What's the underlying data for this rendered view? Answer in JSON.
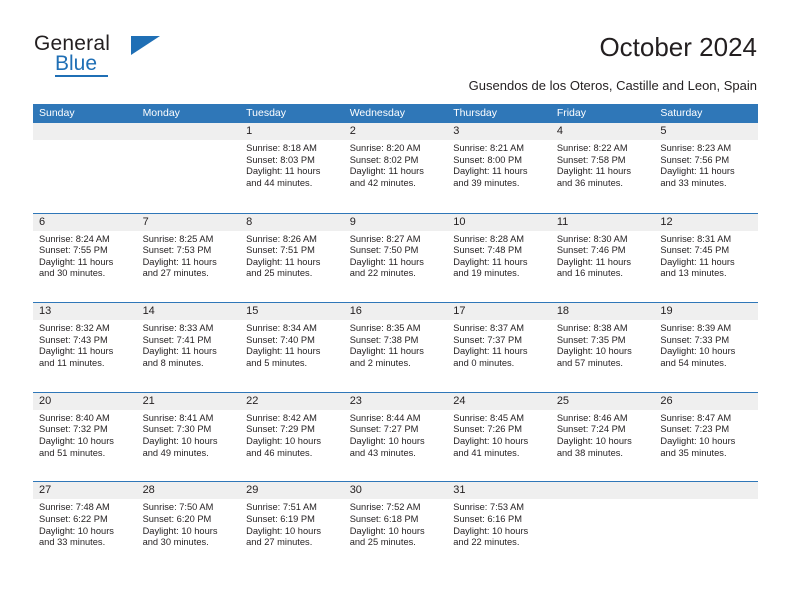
{
  "logo": {
    "word_one": "General",
    "word_two": "Blue",
    "triangle_icon": "triangle-icon",
    "accent_color": "#1f6fb5"
  },
  "header": {
    "title": "October 2024",
    "subtitle": "Gusendos de los Oteros, Castille and Leon, Spain"
  },
  "calendar": {
    "header_bg": "#2f77b8",
    "date_strip_bg": "#efefef",
    "weekdays": [
      "Sunday",
      "Monday",
      "Tuesday",
      "Wednesday",
      "Thursday",
      "Friday",
      "Saturday"
    ],
    "weeks": [
      [
        {
          "date": ""
        },
        {
          "date": ""
        },
        {
          "date": "1",
          "sunrise": "Sunrise: 8:18 AM",
          "sunset": "Sunset: 8:03 PM",
          "daylight_line1": "Daylight: 11 hours",
          "daylight_line2": "and 44 minutes."
        },
        {
          "date": "2",
          "sunrise": "Sunrise: 8:20 AM",
          "sunset": "Sunset: 8:02 PM",
          "daylight_line1": "Daylight: 11 hours",
          "daylight_line2": "and 42 minutes."
        },
        {
          "date": "3",
          "sunrise": "Sunrise: 8:21 AM",
          "sunset": "Sunset: 8:00 PM",
          "daylight_line1": "Daylight: 11 hours",
          "daylight_line2": "and 39 minutes."
        },
        {
          "date": "4",
          "sunrise": "Sunrise: 8:22 AM",
          "sunset": "Sunset: 7:58 PM",
          "daylight_line1": "Daylight: 11 hours",
          "daylight_line2": "and 36 minutes."
        },
        {
          "date": "5",
          "sunrise": "Sunrise: 8:23 AM",
          "sunset": "Sunset: 7:56 PM",
          "daylight_line1": "Daylight: 11 hours",
          "daylight_line2": "and 33 minutes."
        }
      ],
      [
        {
          "date": "6",
          "sunrise": "Sunrise: 8:24 AM",
          "sunset": "Sunset: 7:55 PM",
          "daylight_line1": "Daylight: 11 hours",
          "daylight_line2": "and 30 minutes."
        },
        {
          "date": "7",
          "sunrise": "Sunrise: 8:25 AM",
          "sunset": "Sunset: 7:53 PM",
          "daylight_line1": "Daylight: 11 hours",
          "daylight_line2": "and 27 minutes."
        },
        {
          "date": "8",
          "sunrise": "Sunrise: 8:26 AM",
          "sunset": "Sunset: 7:51 PM",
          "daylight_line1": "Daylight: 11 hours",
          "daylight_line2": "and 25 minutes."
        },
        {
          "date": "9",
          "sunrise": "Sunrise: 8:27 AM",
          "sunset": "Sunset: 7:50 PM",
          "daylight_line1": "Daylight: 11 hours",
          "daylight_line2": "and 22 minutes."
        },
        {
          "date": "10",
          "sunrise": "Sunrise: 8:28 AM",
          "sunset": "Sunset: 7:48 PM",
          "daylight_line1": "Daylight: 11 hours",
          "daylight_line2": "and 19 minutes."
        },
        {
          "date": "11",
          "sunrise": "Sunrise: 8:30 AM",
          "sunset": "Sunset: 7:46 PM",
          "daylight_line1": "Daylight: 11 hours",
          "daylight_line2": "and 16 minutes."
        },
        {
          "date": "12",
          "sunrise": "Sunrise: 8:31 AM",
          "sunset": "Sunset: 7:45 PM",
          "daylight_line1": "Daylight: 11 hours",
          "daylight_line2": "and 13 minutes."
        }
      ],
      [
        {
          "date": "13",
          "sunrise": "Sunrise: 8:32 AM",
          "sunset": "Sunset: 7:43 PM",
          "daylight_line1": "Daylight: 11 hours",
          "daylight_line2": "and 11 minutes."
        },
        {
          "date": "14",
          "sunrise": "Sunrise: 8:33 AM",
          "sunset": "Sunset: 7:41 PM",
          "daylight_line1": "Daylight: 11 hours",
          "daylight_line2": "and 8 minutes."
        },
        {
          "date": "15",
          "sunrise": "Sunrise: 8:34 AM",
          "sunset": "Sunset: 7:40 PM",
          "daylight_line1": "Daylight: 11 hours",
          "daylight_line2": "and 5 minutes."
        },
        {
          "date": "16",
          "sunrise": "Sunrise: 8:35 AM",
          "sunset": "Sunset: 7:38 PM",
          "daylight_line1": "Daylight: 11 hours",
          "daylight_line2": "and 2 minutes."
        },
        {
          "date": "17",
          "sunrise": "Sunrise: 8:37 AM",
          "sunset": "Sunset: 7:37 PM",
          "daylight_line1": "Daylight: 11 hours",
          "daylight_line2": "and 0 minutes."
        },
        {
          "date": "18",
          "sunrise": "Sunrise: 8:38 AM",
          "sunset": "Sunset: 7:35 PM",
          "daylight_line1": "Daylight: 10 hours",
          "daylight_line2": "and 57 minutes."
        },
        {
          "date": "19",
          "sunrise": "Sunrise: 8:39 AM",
          "sunset": "Sunset: 7:33 PM",
          "daylight_line1": "Daylight: 10 hours",
          "daylight_line2": "and 54 minutes."
        }
      ],
      [
        {
          "date": "20",
          "sunrise": "Sunrise: 8:40 AM",
          "sunset": "Sunset: 7:32 PM",
          "daylight_line1": "Daylight: 10 hours",
          "daylight_line2": "and 51 minutes."
        },
        {
          "date": "21",
          "sunrise": "Sunrise: 8:41 AM",
          "sunset": "Sunset: 7:30 PM",
          "daylight_line1": "Daylight: 10 hours",
          "daylight_line2": "and 49 minutes."
        },
        {
          "date": "22",
          "sunrise": "Sunrise: 8:42 AM",
          "sunset": "Sunset: 7:29 PM",
          "daylight_line1": "Daylight: 10 hours",
          "daylight_line2": "and 46 minutes."
        },
        {
          "date": "23",
          "sunrise": "Sunrise: 8:44 AM",
          "sunset": "Sunset: 7:27 PM",
          "daylight_line1": "Daylight: 10 hours",
          "daylight_line2": "and 43 minutes."
        },
        {
          "date": "24",
          "sunrise": "Sunrise: 8:45 AM",
          "sunset": "Sunset: 7:26 PM",
          "daylight_line1": "Daylight: 10 hours",
          "daylight_line2": "and 41 minutes."
        },
        {
          "date": "25",
          "sunrise": "Sunrise: 8:46 AM",
          "sunset": "Sunset: 7:24 PM",
          "daylight_line1": "Daylight: 10 hours",
          "daylight_line2": "and 38 minutes."
        },
        {
          "date": "26",
          "sunrise": "Sunrise: 8:47 AM",
          "sunset": "Sunset: 7:23 PM",
          "daylight_line1": "Daylight: 10 hours",
          "daylight_line2": "and 35 minutes."
        }
      ],
      [
        {
          "date": "27",
          "sunrise": "Sunrise: 7:48 AM",
          "sunset": "Sunset: 6:22 PM",
          "daylight_line1": "Daylight: 10 hours",
          "daylight_line2": "and 33 minutes."
        },
        {
          "date": "28",
          "sunrise": "Sunrise: 7:50 AM",
          "sunset": "Sunset: 6:20 PM",
          "daylight_line1": "Daylight: 10 hours",
          "daylight_line2": "and 30 minutes."
        },
        {
          "date": "29",
          "sunrise": "Sunrise: 7:51 AM",
          "sunset": "Sunset: 6:19 PM",
          "daylight_line1": "Daylight: 10 hours",
          "daylight_line2": "and 27 minutes."
        },
        {
          "date": "30",
          "sunrise": "Sunrise: 7:52 AM",
          "sunset": "Sunset: 6:18 PM",
          "daylight_line1": "Daylight: 10 hours",
          "daylight_line2": "and 25 minutes."
        },
        {
          "date": "31",
          "sunrise": "Sunrise: 7:53 AM",
          "sunset": "Sunset: 6:16 PM",
          "daylight_line1": "Daylight: 10 hours",
          "daylight_line2": "and 22 minutes."
        },
        {
          "date": ""
        },
        {
          "date": ""
        }
      ]
    ]
  }
}
